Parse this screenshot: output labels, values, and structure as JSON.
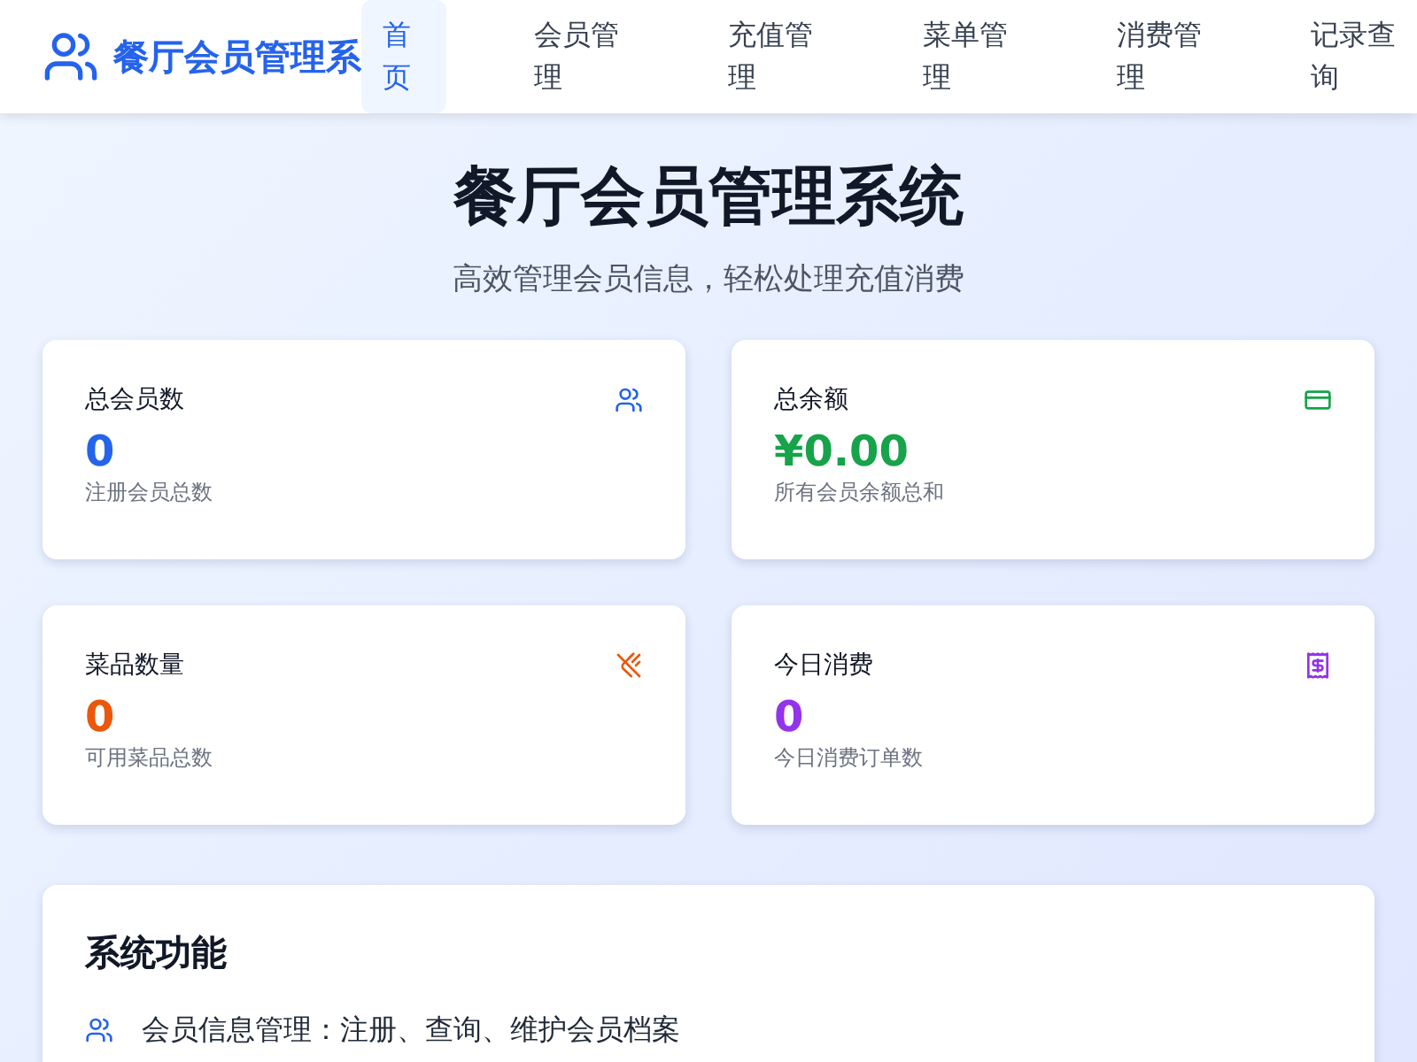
{
  "header": {
    "title": "餐厅会员管理系",
    "nav": [
      {
        "label": "首页",
        "selected": true
      },
      {
        "label": "会员管理",
        "selected": false
      },
      {
        "label": "充值管理",
        "selected": false
      },
      {
        "label": "菜单管理",
        "selected": false
      },
      {
        "label": "消费管理",
        "selected": false
      },
      {
        "label": "记录查询",
        "selected": false
      }
    ]
  },
  "hero": {
    "title": "餐厅会员管理系统",
    "subtitle": "高效管理会员信息，轻松处理充值消费"
  },
  "stats": [
    {
      "kind": "members",
      "label": "总会员数",
      "value": "0",
      "caption": "注册会员总数"
    },
    {
      "kind": "balance",
      "label": "总余额",
      "value": "¥0.00",
      "caption": "所有会员余额总和"
    },
    {
      "kind": "dishes",
      "label": "菜品数量",
      "value": "0",
      "caption": "可用菜品总数"
    },
    {
      "kind": "spending",
      "label": "今日消费",
      "value": "0",
      "caption": "今日消费订单数"
    }
  ],
  "features": {
    "title": "系统功能",
    "items": [
      {
        "kind": "members",
        "text": "会员信息管理：注册、查询、维护会员档案"
      }
    ]
  }
}
